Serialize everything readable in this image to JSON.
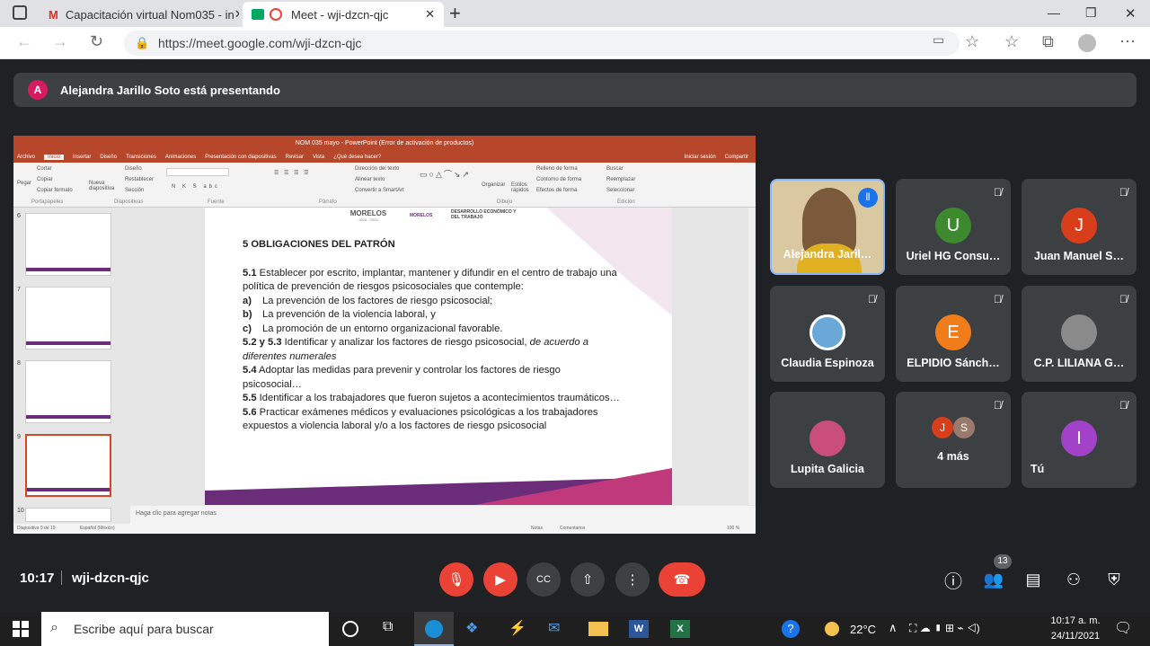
{
  "browser": {
    "tabs": [
      {
        "label": "Capacitación virtual Nom035 - in",
        "close": "✕"
      },
      {
        "label": "Meet - wji-dzcn-qjc",
        "close": "✕"
      }
    ],
    "new_tab": "+",
    "url": "https://meet.google.com/wji-dzcn-qjc",
    "window_controls": [
      "—",
      "❐",
      "✕"
    ]
  },
  "meet": {
    "presenting_avatar": "A",
    "presenting_text": "Alejandra Jarillo Soto está presentando",
    "participants": [
      {
        "name": "Alejandra Jaril…",
        "color": "#c9a227"
      },
      {
        "name": "Uriel HG Consu…",
        "initial": "U",
        "color": "#3d8a2e"
      },
      {
        "name": "Juan Manuel S…",
        "initial": "J",
        "color": "#d93e1a"
      },
      {
        "name": "Claudia Espinoza",
        "color": "#6aa8d8"
      },
      {
        "name": "ELPIDIO Sánch…",
        "initial": "E",
        "color": "#f07d1a"
      },
      {
        "name": "C.P. LILIANA G…",
        "color": "#8a8a8a"
      },
      {
        "name": "Lupita Galicia",
        "color": "#c94f7a"
      },
      {
        "name": "4 más",
        "initials": [
          "J",
          "S"
        ],
        "colors": [
          "#d93e1a",
          "#9b7a6e"
        ]
      },
      {
        "name": "Tú",
        "initial": "I",
        "color": "#a142c9"
      }
    ],
    "time": "10:17",
    "meeting_code": "wji-dzcn-qjc",
    "people_count": "13"
  },
  "ppt": {
    "window_title": "NOM 035 mayo - PowerPoint (Error de activación de productos)",
    "tabs": [
      "Archivo",
      "Inicio",
      "Insertar",
      "Diseño",
      "Transiciones",
      "Animaciones",
      "Presentación con diapositivas",
      "Revisar",
      "Vista",
      "¿Qué desea hacer?"
    ],
    "sign_in": "Iniciar sesión",
    "share": "Compartir",
    "ribbon": [
      "Pegar",
      "Cortar",
      "Copiar",
      "Copiar formato",
      "Nueva diapositiva",
      "Diseño",
      "Restablecer",
      "Sección",
      "Dirección del texto",
      "Alinear texto",
      "Convertir a SmartArt",
      "Organizar",
      "Estilos rápidos",
      "Relleno de forma",
      "Contorno de forma",
      "Efectos de forma",
      "Buscar",
      "Reemplazar",
      "Seleccionar"
    ],
    "ribbon_groups": [
      "Portapapeles",
      "Diapositivas",
      "Fuente",
      "Párrafo",
      "Dibujo",
      "Edición"
    ],
    "thumb_numbers": [
      "6",
      "7",
      "8",
      "9",
      "10"
    ],
    "slide_logo1": "MORELOS",
    "slide_logo1_sub": "2018 - 2024",
    "slide_logo2": "MORELOS",
    "slide_dept": "DESARROLLO ECONÓMICO Y DEL TRABAJO",
    "slide_title": "5 OBLIGACIONES DEL PATRÓN",
    "s51_num": "5.1",
    "s51_text": " Establecer por escrito, implantar, mantener y difundir en el centro de trabajo una política de prevención de riesgos psicosociales que contemple:",
    "a_label": "a)",
    "a_text": "La prevención de los factores de riesgo psicosocial;",
    "b_label": "b)",
    "b_text": "La prevención de la violencia laboral, y",
    "c_label": "c)",
    "c_text": "La promoción de un entorno organizacional favorable.",
    "s52_num": "5.2 y 5.3",
    "s52_text": " Identificar y analizar los factores de riesgo psicosocial, ",
    "s52_italic": "de acuerdo a diferentes numerales",
    "s54_num": "5.4",
    "s54_text": " Adoptar las medidas para prevenir y controlar los factores de riesgo psicosocial…",
    "s55_num": "5.5",
    "s55_text": " Identificar a los trabajadores que fueron sujetos a acontecimientos traumáticos…",
    "s56_num": "5.6",
    "s56_text": " Practicar exámenes médicos y evaluaciones psicológicas a los trabajadores expuestos a violencia laboral y/o a los factores de riesgo psicosocial",
    "notes_placeholder": "Haga clic para agregar notas",
    "status_left": "Diapositiva 9 de 19",
    "status_lang": "Español (México)",
    "status_notes": "Notas",
    "status_comments": "Comentarios",
    "zoom": "100 %"
  },
  "taskbar": {
    "search_placeholder": "Escribe aquí para buscar",
    "temperature": "22°C",
    "clock_time": "10:17 a. m.",
    "clock_date": "24/11/2021"
  }
}
